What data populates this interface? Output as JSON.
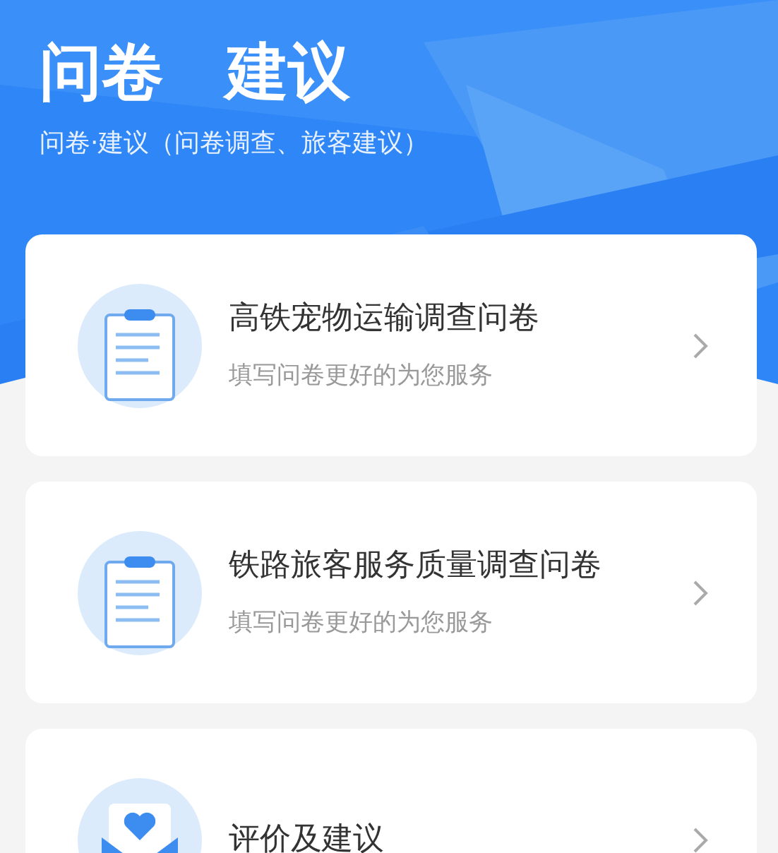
{
  "header": {
    "title": "问卷　建议",
    "subtitle": "问卷·建议（问卷调查、旅客建议）"
  },
  "items": [
    {
      "kind": "clipboard",
      "title": "高铁宠物运输调查问卷",
      "subtitle": "填写问卷更好的为您服务"
    },
    {
      "kind": "clipboard",
      "title": "铁路旅客服务质量调查问卷",
      "subtitle": "填写问卷更好的为您服务"
    },
    {
      "kind": "envelope",
      "title": "评价及建议"
    }
  ]
}
